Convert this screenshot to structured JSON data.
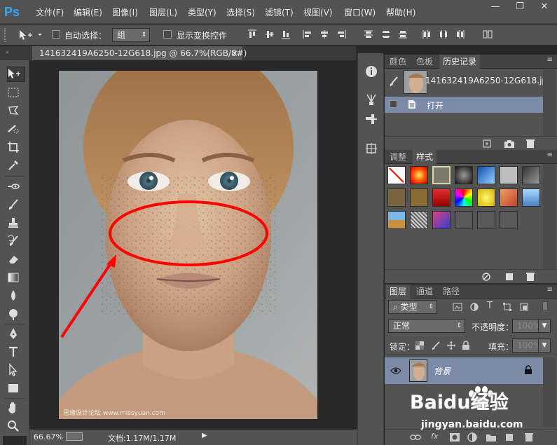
{
  "menubar": {
    "logo": "Ps",
    "items": [
      "文件(F)",
      "编辑(E)",
      "图像(I)",
      "图层(L)",
      "类型(Y)",
      "选择(S)",
      "滤镜(T)",
      "视图(V)",
      "窗口(W)",
      "帮助(H)"
    ],
    "window_controls": {
      "minimize": "—",
      "restore": "❐",
      "close": "✕"
    }
  },
  "options": {
    "auto_select_label": "自动选择：",
    "auto_select_value": "组",
    "show_transform_label": "显示变换控件"
  },
  "document_tab": {
    "title": "141632419A6250-12G618.jpg @ 66.7%(RGB/8#)",
    "close": "×"
  },
  "canvas": {
    "watermark": "思缘设计论坛 www.missyuan.com"
  },
  "statusbar": {
    "zoom": "66.67%",
    "doc_info": "文档:1.17M/1.17M"
  },
  "history_panel": {
    "tabs": [
      "颜色",
      "色板",
      "历史记录"
    ],
    "active_tab": "历史记录",
    "snapshot_name": "141632419A6250-12G618.jpg",
    "states": [
      "打开"
    ]
  },
  "styles_panel": {
    "tabs": [
      "调整",
      "样式"
    ],
    "active_tab": "样式"
  },
  "layers_panel": {
    "tabs": [
      "图层",
      "通道",
      "路径"
    ],
    "active_tab": "图层",
    "filter_kind": "类型",
    "blend_mode": "正常",
    "opacity_label": "不透明度：",
    "opacity_value": "100%",
    "lock_label": "锁定：",
    "fill_label": "填充：",
    "fill_value": "100%",
    "layers": [
      {
        "name": "背景"
      }
    ],
    "footer_icons": [
      "link-icon",
      "fx-icon",
      "mask-icon",
      "adjustment-icon",
      "group-icon",
      "new-layer-icon",
      "trash-icon"
    ]
  },
  "overlay": {
    "brand": "Baidu经验",
    "url": "jingyan.baidu.com"
  },
  "colors": {
    "panel_bg": "#535353",
    "canvas_bg": "#282828",
    "selection_highlight": "#7b8aa6",
    "annotation_red": "#ff0000",
    "ps_blue": "#31a8ff"
  }
}
